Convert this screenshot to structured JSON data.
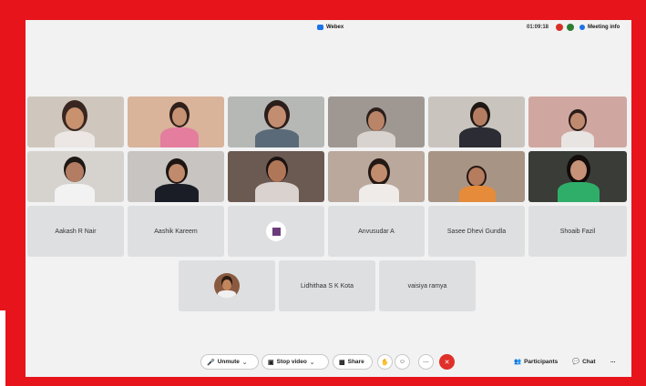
{
  "window": {
    "app_name": "Webex",
    "timer": "01:09:18",
    "meeting_info": "Meeting info"
  },
  "participants_named": [
    {
      "name": "Aakash R Nair"
    },
    {
      "name": "Aashik Kareem"
    },
    {
      "name": "Anvusudar A"
    },
    {
      "name": "Sasee Dhevi Gundla"
    },
    {
      "name": "Shoaib Fazil"
    },
    {
      "name": "Lidhithaa S K Kota"
    },
    {
      "name": "vaisiya ramya"
    }
  ],
  "controls": {
    "unmute": "Unmute",
    "stop_video": "Stop video",
    "share": "Share",
    "participants": "Participants",
    "chat": "Chat",
    "more": "..."
  },
  "icons": {
    "mic": "mic-muted-icon",
    "video": "video-icon",
    "share": "share-icon",
    "end": "end-call-icon"
  },
  "colors": {
    "frame": "#e8141b",
    "end_call": "#e0302a",
    "accent": "#1a73e8"
  }
}
